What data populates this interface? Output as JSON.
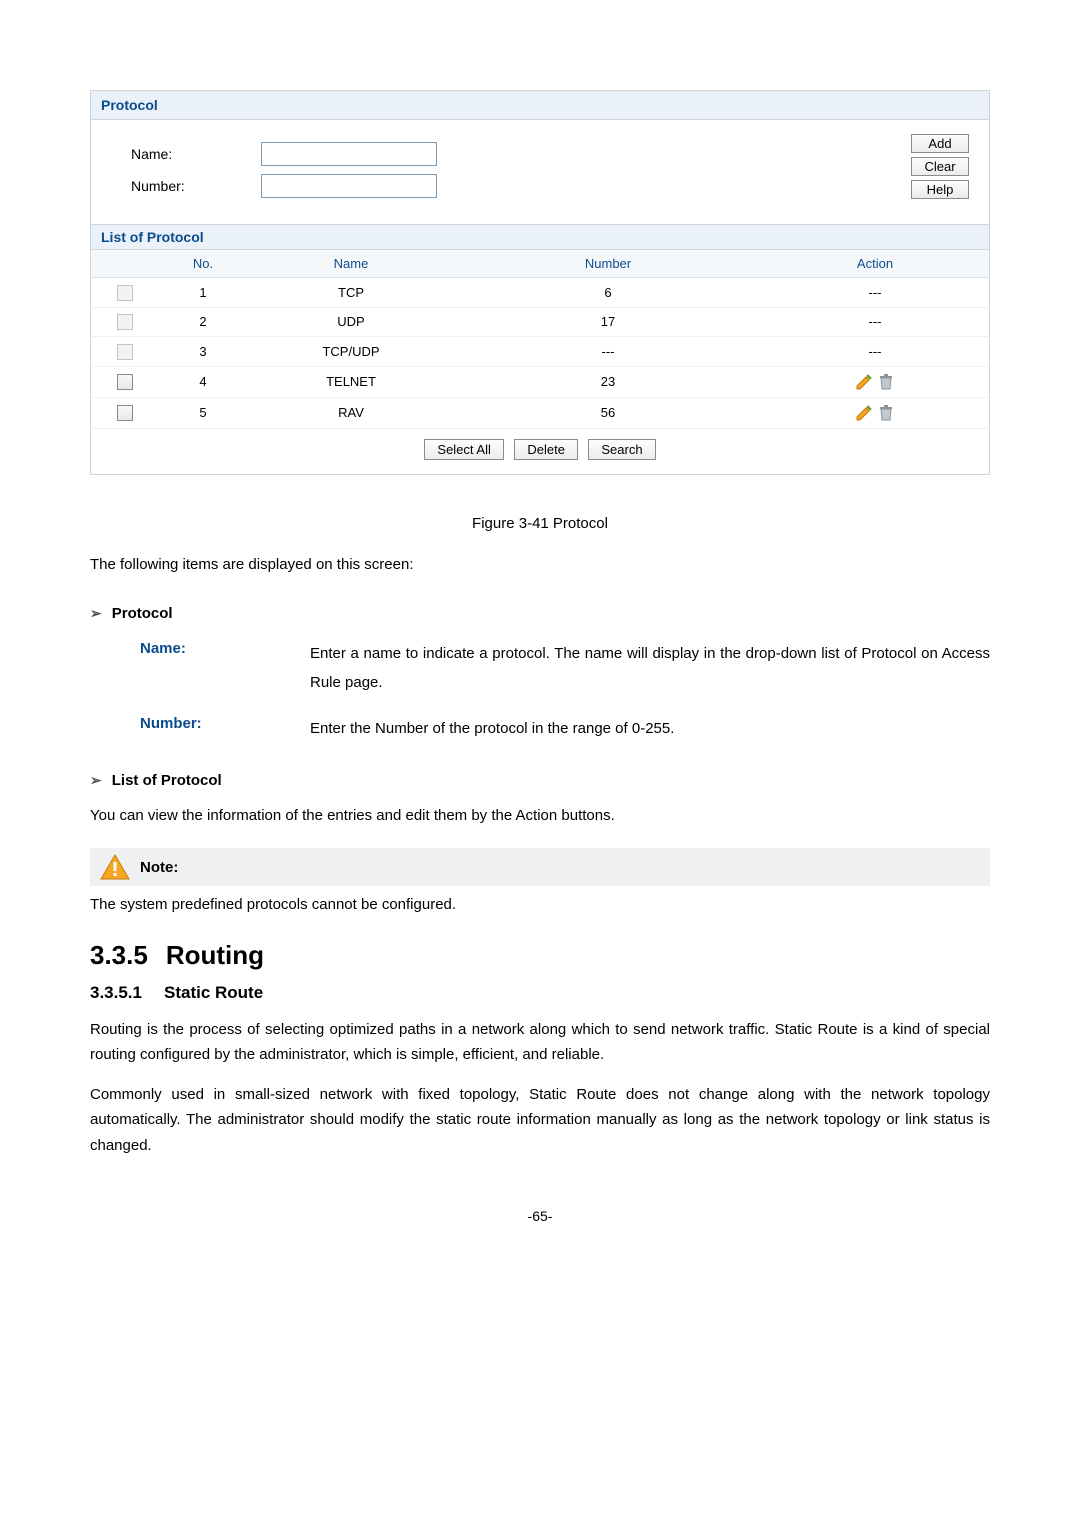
{
  "panel": {
    "title": "Protocol",
    "form": {
      "name_label": "Name:",
      "number_label": "Number:"
    },
    "buttons": {
      "add": "Add",
      "clear": "Clear",
      "help": "Help",
      "select_all": "Select All",
      "delete": "Delete",
      "search": "Search"
    },
    "list_title": "List of Protocol",
    "columns": {
      "no": "No.",
      "name": "Name",
      "number": "Number",
      "action": "Action"
    },
    "rows": [
      {
        "no": "1",
        "name": "TCP",
        "number": "6",
        "action": "---",
        "editable": false
      },
      {
        "no": "2",
        "name": "UDP",
        "number": "17",
        "action": "---",
        "editable": false
      },
      {
        "no": "3",
        "name": "TCP/UDP",
        "number": "---",
        "action": "---",
        "editable": false
      },
      {
        "no": "4",
        "name": "TELNET",
        "number": "23",
        "action": "icons",
        "editable": true
      },
      {
        "no": "5",
        "name": "RAV",
        "number": "56",
        "action": "icons",
        "editable": true
      }
    ]
  },
  "caption": "Figure 3-41 Protocol",
  "intro_text": "The following items are displayed on this screen:",
  "section_protocol": "Protocol",
  "defs": {
    "name_term": "Name:",
    "name_desc": "Enter a name to indicate a protocol. The name will display in the drop-down list of Protocol on Access Rule page.",
    "number_term": "Number:",
    "number_desc": "Enter the Number of the protocol in the range of 0-255."
  },
  "section_list": "List of Protocol",
  "list_desc": "You can view the information of the entries and edit them by the Action buttons.",
  "note_label": "Note:",
  "note_text": "The system predefined protocols cannot be configured.",
  "h2_num": "3.3.5",
  "h2_title": "Routing",
  "h3_num": "3.3.5.1",
  "h3_title": "Static Route",
  "para1": "Routing is the process of selecting optimized paths in a network along which to send network traffic. Static Route is a kind of special routing configured by the administrator, which is simple, efficient, and reliable.",
  "para2": "Commonly used in small-sized network with fixed topology, Static Route does not change along with the network topology automatically. The administrator should modify the static route information manually as long as the network topology or link status is changed.",
  "page_number": "-65-"
}
